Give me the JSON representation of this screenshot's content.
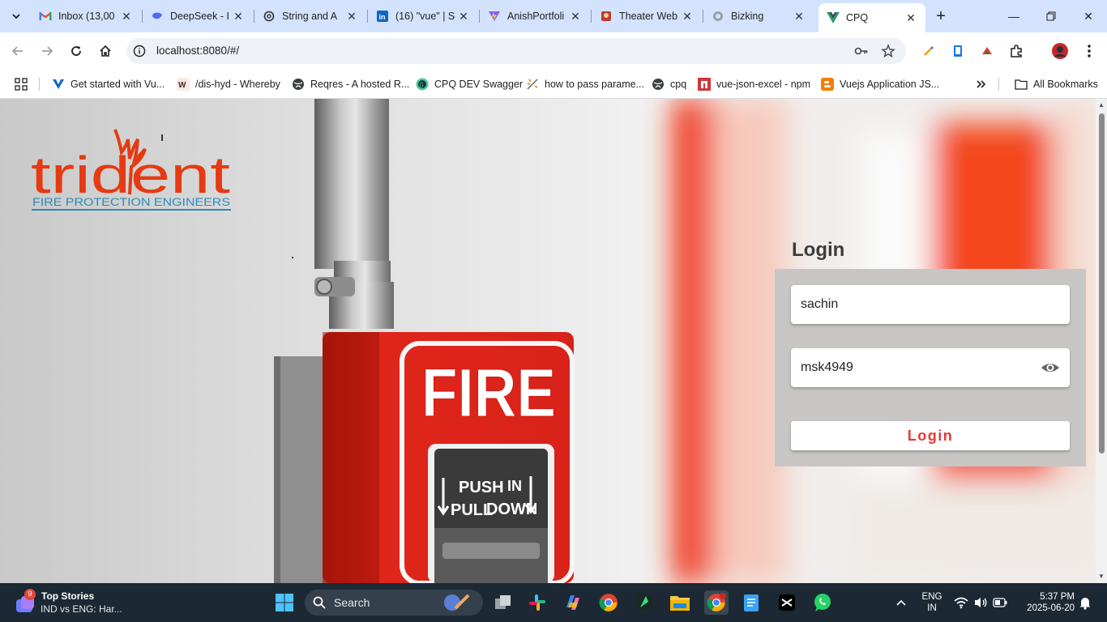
{
  "browser": {
    "tabs": [
      {
        "title": "Inbox (13,00",
        "icon": "gmail-icon"
      },
      {
        "title": "DeepSeek - I",
        "icon": "deepseek-icon"
      },
      {
        "title": "String and A",
        "icon": "chatgpt-icon"
      },
      {
        "title": "(16) \"vue\" | S",
        "icon": "linkedin-icon"
      },
      {
        "title": "AnishPortfoli",
        "icon": "vite-icon"
      },
      {
        "title": "Theater Web",
        "icon": "theater-icon"
      },
      {
        "title": "Bizking",
        "icon": "globe-icon"
      },
      {
        "title": "CPQ",
        "icon": "vue-icon"
      }
    ],
    "active_tab_index": 7,
    "url": "localhost:8080/#/",
    "bookmarks": [
      {
        "label": "Get started with Vu...",
        "icon": "vuetify-icon"
      },
      {
        "label": "/dis-hyd - Whereby",
        "icon": "whereby-icon"
      },
      {
        "label": "Reqres - A hosted R...",
        "icon": "globe-icon"
      },
      {
        "label": "CPQ DEV Swagger",
        "icon": "swagger-icon"
      },
      {
        "label": "how to pass parame...",
        "icon": "sparkle-icon"
      },
      {
        "label": "cpq",
        "icon": "globe-icon"
      },
      {
        "label": "vue-json-excel - npm",
        "icon": "npm-icon"
      },
      {
        "label": "Vuejs Application JS...",
        "icon": "blogger-icon"
      }
    ],
    "all_bookmarks_label": "All Bookmarks"
  },
  "page": {
    "logo": {
      "name": "trident",
      "tagline": "FIRE PROTECTION ENGINEERS"
    },
    "alarm": {
      "fire_text": "FIRE",
      "push_text": "PUSH",
      "in_text": "IN",
      "pull_text": "PULL",
      "down_text": "DOWN"
    },
    "login": {
      "title": "Login",
      "username_value": "sachin",
      "password_value": "msk4949",
      "button_label": "Login"
    },
    "colors": {
      "accent": "#e53935",
      "card": "#c8c6c5"
    }
  },
  "taskbar": {
    "news_badge": "9",
    "news_title": "Top Stories",
    "news_subtitle": "IND vs ENG: Har...",
    "search_label": "Search",
    "language": "ENG",
    "region": "IN",
    "time": "5:37 PM",
    "date": "2025-06-20"
  }
}
